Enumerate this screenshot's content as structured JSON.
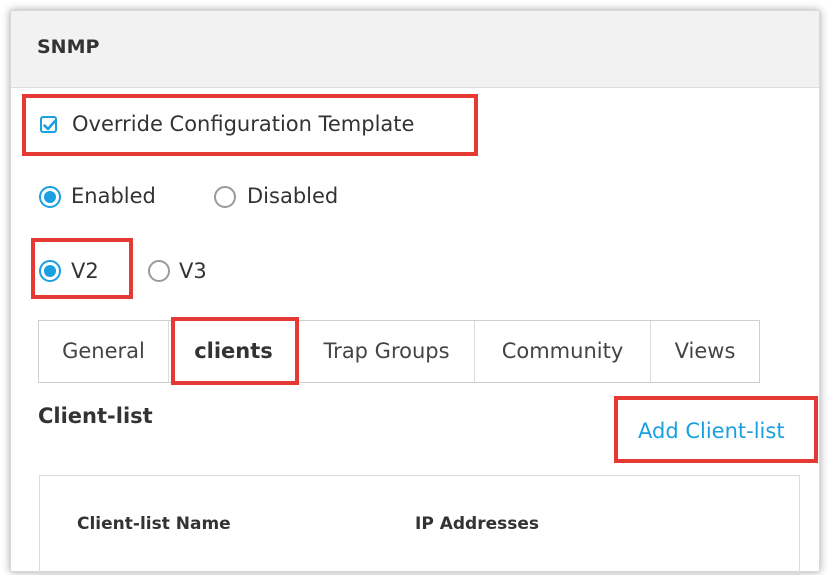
{
  "panel": {
    "title": "SNMP",
    "override_label": "Override Configuration Template",
    "override_checked": true
  },
  "status": {
    "options": [
      {
        "label": "Enabled",
        "selected": true
      },
      {
        "label": "Disabled",
        "selected": false
      }
    ]
  },
  "version": {
    "options": [
      {
        "label": "V2",
        "selected": true
      },
      {
        "label": "V3",
        "selected": false
      }
    ]
  },
  "tabs": [
    {
      "label": "General",
      "active": false
    },
    {
      "label": "clients",
      "active": true
    },
    {
      "label": "Trap Groups",
      "active": false
    },
    {
      "label": "Community",
      "active": false
    },
    {
      "label": "Views",
      "active": false
    }
  ],
  "client_list": {
    "title": "Client-list",
    "add_link": "Add Client-list",
    "columns": [
      "Client-list Name",
      "IP Addresses"
    ]
  },
  "colors": {
    "accent": "#1a9fe0",
    "highlight": "#e53a33",
    "header_bg": "#f2f2f2"
  }
}
